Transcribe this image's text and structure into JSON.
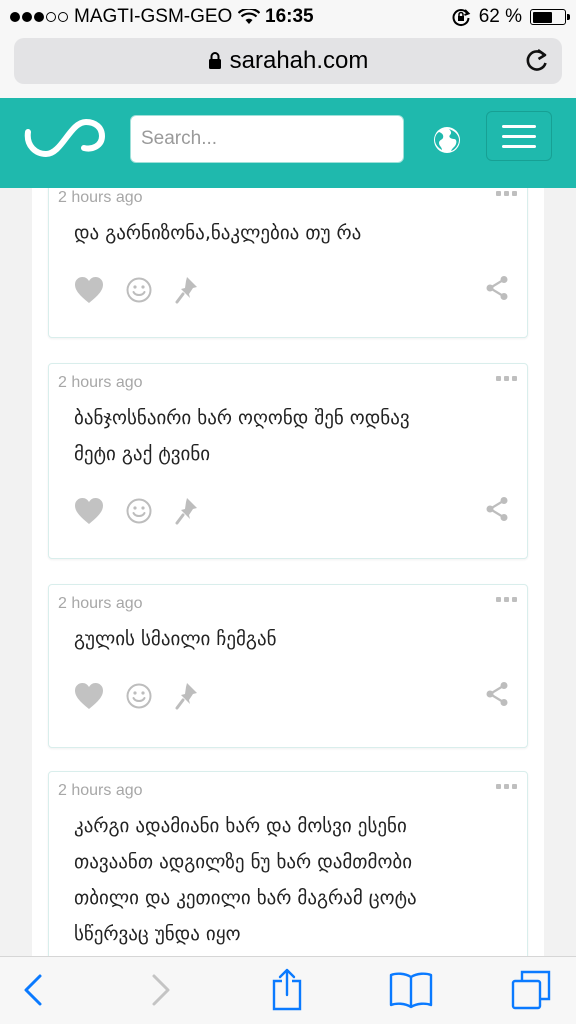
{
  "status_bar": {
    "carrier": "MAGTI-GSM-GEO",
    "time": "16:35",
    "battery_percent": "62 %",
    "battery_level": 0.62
  },
  "address_bar": {
    "url": "sarahah.com"
  },
  "header": {
    "search_placeholder": "Search...",
    "accent_color": "#1fb9ad"
  },
  "messages": [
    {
      "time": "2 hours ago",
      "lines": [
        "და გარნიზონა,ნაკლებია თუ რა"
      ]
    },
    {
      "time": "2 hours ago",
      "lines": [
        "ბანჯოსნაირი ხარ ოღონდ შენ ოდნავ",
        "მეტი გაქ ტვინი"
      ]
    },
    {
      "time": "2 hours ago",
      "lines": [
        "გულის სმაილი ჩემგან"
      ]
    },
    {
      "time": "2 hours ago",
      "lines": [
        "კარგი ადამიანი ხარ და მოსვი ესენი",
        "თავაანთ ადგილზე ნუ ხარ დამთმობი",
        "თბილი და კეთილი ხარ მაგრამ ცოტა",
        "სწერვაც უნდა იყო"
      ]
    }
  ]
}
